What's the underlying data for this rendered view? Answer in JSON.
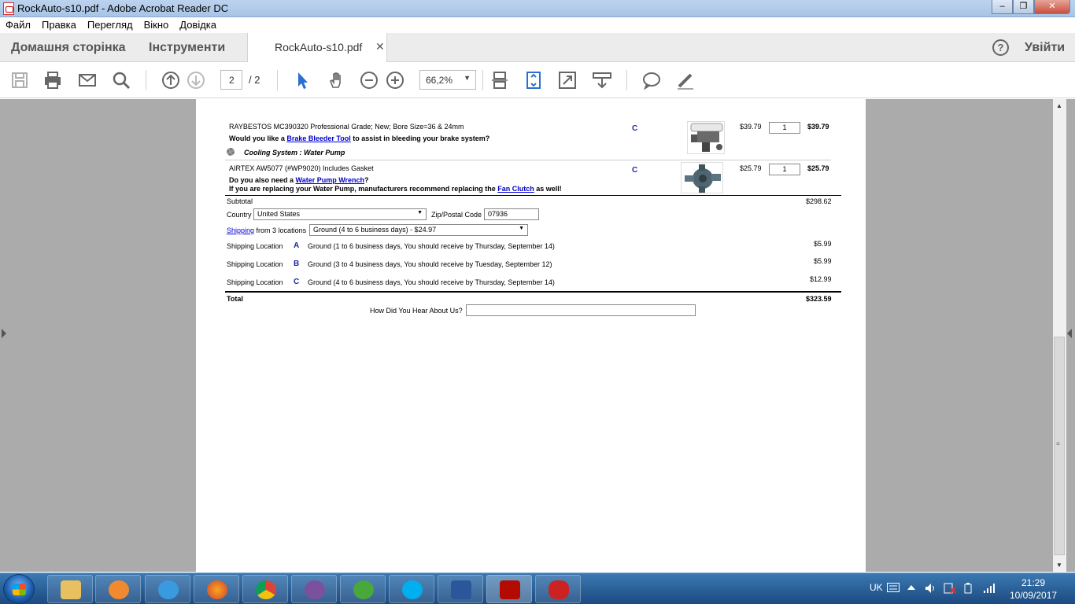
{
  "window": {
    "title": "RockAuto-s10.pdf - Adobe Acrobat Reader DC",
    "min_label": "‒",
    "max_label": "❐",
    "close_label": "✕"
  },
  "menu": [
    "Файл",
    "Правка",
    "Перегляд",
    "Вікно",
    "Довідка"
  ],
  "tabs": {
    "home": "Домашня сторінка",
    "tools": "Інструменти",
    "document": "RockAuto-s10.pdf",
    "document_close": "✕",
    "help": "?",
    "signin": "Увійти"
  },
  "toolbar": {
    "page_current": "2",
    "page_total": "/ 2",
    "zoom": "66,2%",
    "zoom_arrow": "▼"
  },
  "document": {
    "item1": {
      "desc": "RAYBESTOS MC390320 Professional Grade; New; Bore Size=36 & 24mm",
      "upsell_pre": "Would you like a ",
      "upsell_link": "Brake Bleeder Tool",
      "upsell_post": " to assist in bleeding your brake system?",
      "location": "C",
      "price": "$39.79",
      "qty": "1",
      "total": "$39.79"
    },
    "category": "Cooling System : Water Pump",
    "item2": {
      "desc": "AIRTEX AW5077 (#WP9020) Includes Gasket",
      "upsell_pre": "Do you also need a ",
      "upsell_link": "Water Pump Wrench",
      "upsell_post": "?",
      "note_pre": "If you are replacing your Water Pump, manufacturers recommend replacing the ",
      "note_link": "Fan Clutch",
      "note_post": " as well!",
      "location": "C",
      "price": "$25.79",
      "qty": "1",
      "total": "$25.79"
    },
    "subtotal_label": "Subtotal",
    "subtotal_value": "$298.62",
    "country_label": "Country",
    "country_value": "United States",
    "zip_label": "Zip/Postal Code",
    "zip_value": "07936",
    "shipping_link": "Shipping",
    "shipping_from": "from 3 locations",
    "shipping_option": "Ground (4 to 6 business days) - $24.97",
    "select_arrow": "▼",
    "ship_locations": [
      {
        "label": "Shipping Location",
        "code": "A",
        "desc": "Ground (1 to 6 business days, You should receive by Thursday, September 14)",
        "price": "$5.99"
      },
      {
        "label": "Shipping Location",
        "code": "B",
        "desc": "Ground (3 to 4 business days, You should receive by Tuesday, September 12)",
        "price": "$5.99"
      },
      {
        "label": "Shipping Location",
        "code": "C",
        "desc": "Ground (4 to 6 business days, You should receive by Thursday, September 14)",
        "price": "$12.99"
      }
    ],
    "total_label": "Total",
    "total_value": "$323.59",
    "hear_label": "How Did You Hear About Us?"
  },
  "scrollbar": {
    "up": "▲",
    "down": "▼",
    "grip": "≡"
  },
  "taskbar": {
    "apps": [
      "file-explorer",
      "media-player",
      "internet-explorer",
      "firefox",
      "chrome",
      "viber",
      "utorrent",
      "skype",
      "word",
      "acrobat-reader",
      "game"
    ],
    "lang": "UK",
    "time": "21:29",
    "date": "10/09/2017"
  },
  "colors": {
    "link": "#0000cc",
    "location_code": "#1a2aa0",
    "viewer_bg": "#ababab",
    "accent_blue": "#2d6fd0"
  }
}
